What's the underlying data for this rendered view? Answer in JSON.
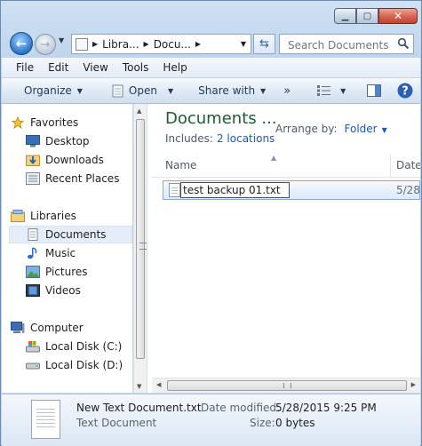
{
  "window": {
    "min_glyph": "▁",
    "max_glyph": "▢",
    "close_glyph": "✕"
  },
  "nav": {
    "breadcrumb": [
      "Libra...",
      "Docu..."
    ],
    "search_placeholder": "Search Documents"
  },
  "menu": [
    "File",
    "Edit",
    "View",
    "Tools",
    "Help"
  ],
  "toolbar": {
    "organize": "Organize",
    "open": "Open",
    "share": "Share with",
    "more": "»"
  },
  "sidebar": {
    "favorites": {
      "label": "Favorites",
      "items": [
        "Desktop",
        "Downloads",
        "Recent Places"
      ]
    },
    "libraries": {
      "label": "Libraries",
      "items": [
        "Documents",
        "Music",
        "Pictures",
        "Videos"
      ],
      "selected": "Documents"
    },
    "computer": {
      "label": "Computer",
      "items": [
        "Local Disk (C:)",
        "Local Disk (D:)"
      ]
    }
  },
  "content": {
    "title": "Documents ...",
    "includes_label": "Includes:",
    "includes_link": "2 locations",
    "arrange_label": "Arrange by:",
    "arrange_value": "Folder",
    "columns": {
      "name": "Name",
      "date": "Date"
    },
    "file": {
      "rename_text": "test backup 01.txt",
      "date": "5/28"
    }
  },
  "details": {
    "name": "New Text Document.txt",
    "type": "Text Document",
    "date_modified_label": "Date modified:",
    "date_modified": "5/28/2015 9:25 PM",
    "size_label": "Size:",
    "size": "0 bytes"
  },
  "colors": {
    "accent": "#1c5bb5",
    "title_green": "#1e5a36"
  }
}
